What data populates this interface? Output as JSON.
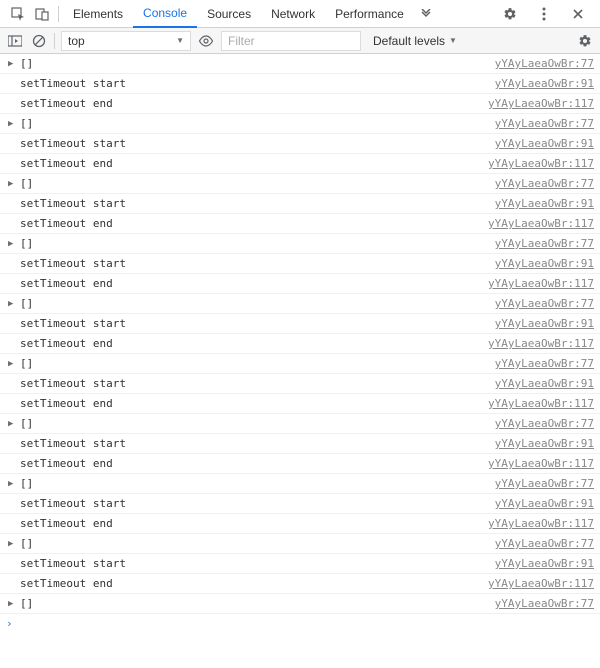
{
  "tabs": {
    "elements": "Elements",
    "console": "Console",
    "sources": "Sources",
    "network": "Network",
    "performance": "Performance"
  },
  "filterBar": {
    "context": "top",
    "filterPlaceholder": "Filter",
    "levels": "Default levels"
  },
  "sourceFile": "yYAyLaeaOwBr",
  "rows": [
    {
      "type": "arr",
      "msg": "[]",
      "line": 77
    },
    {
      "type": "log",
      "msg": "setTimeout start",
      "line": 91
    },
    {
      "type": "log",
      "msg": "setTimeout end",
      "line": 117
    },
    {
      "type": "arr",
      "msg": "[]",
      "line": 77
    },
    {
      "type": "log",
      "msg": "setTimeout start",
      "line": 91
    },
    {
      "type": "log",
      "msg": "setTimeout end",
      "line": 117
    },
    {
      "type": "arr",
      "msg": "[]",
      "line": 77
    },
    {
      "type": "log",
      "msg": "setTimeout start",
      "line": 91
    },
    {
      "type": "log",
      "msg": "setTimeout end",
      "line": 117
    },
    {
      "type": "arr",
      "msg": "[]",
      "line": 77
    },
    {
      "type": "log",
      "msg": "setTimeout start",
      "line": 91
    },
    {
      "type": "log",
      "msg": "setTimeout end",
      "line": 117
    },
    {
      "type": "arr",
      "msg": "[]",
      "line": 77
    },
    {
      "type": "log",
      "msg": "setTimeout start",
      "line": 91
    },
    {
      "type": "log",
      "msg": "setTimeout end",
      "line": 117
    },
    {
      "type": "arr",
      "msg": "[]",
      "line": 77
    },
    {
      "type": "log",
      "msg": "setTimeout start",
      "line": 91
    },
    {
      "type": "log",
      "msg": "setTimeout end",
      "line": 117
    },
    {
      "type": "arr",
      "msg": "[]",
      "line": 77
    },
    {
      "type": "log",
      "msg": "setTimeout start",
      "line": 91
    },
    {
      "type": "log",
      "msg": "setTimeout end",
      "line": 117
    },
    {
      "type": "arr",
      "msg": "[]",
      "line": 77
    },
    {
      "type": "log",
      "msg": "setTimeout start",
      "line": 91
    },
    {
      "type": "log",
      "msg": "setTimeout end",
      "line": 117
    },
    {
      "type": "arr",
      "msg": "[]",
      "line": 77
    },
    {
      "type": "log",
      "msg": "setTimeout start",
      "line": 91
    },
    {
      "type": "log",
      "msg": "setTimeout end",
      "line": 117
    },
    {
      "type": "arr",
      "msg": "[]",
      "line": 77
    }
  ]
}
